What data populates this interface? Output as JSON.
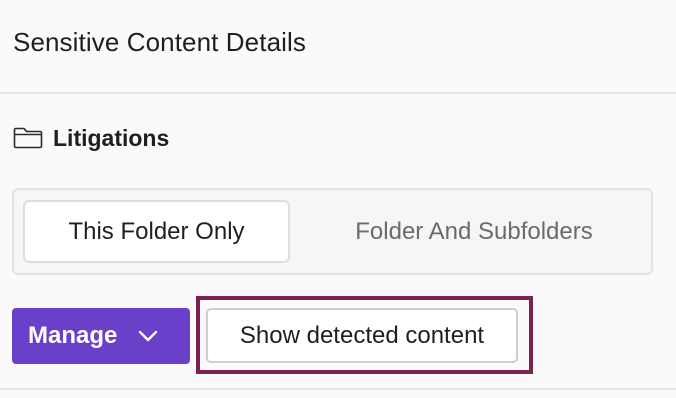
{
  "panel": {
    "title": "Sensitive Content Details"
  },
  "folder": {
    "icon": "folder-outline-icon",
    "name": "Litigations"
  },
  "scope_toggle": {
    "options": [
      {
        "label": "This Folder Only",
        "selected": true
      },
      {
        "label": "Folder And Subfolders",
        "selected": false
      }
    ]
  },
  "actions": {
    "manage_label": "Manage",
    "manage_icon": "chevron-down-icon",
    "show_detected_label": "Show detected content"
  },
  "colors": {
    "accent": "#6a3fc9",
    "highlight": "#7d2250"
  }
}
